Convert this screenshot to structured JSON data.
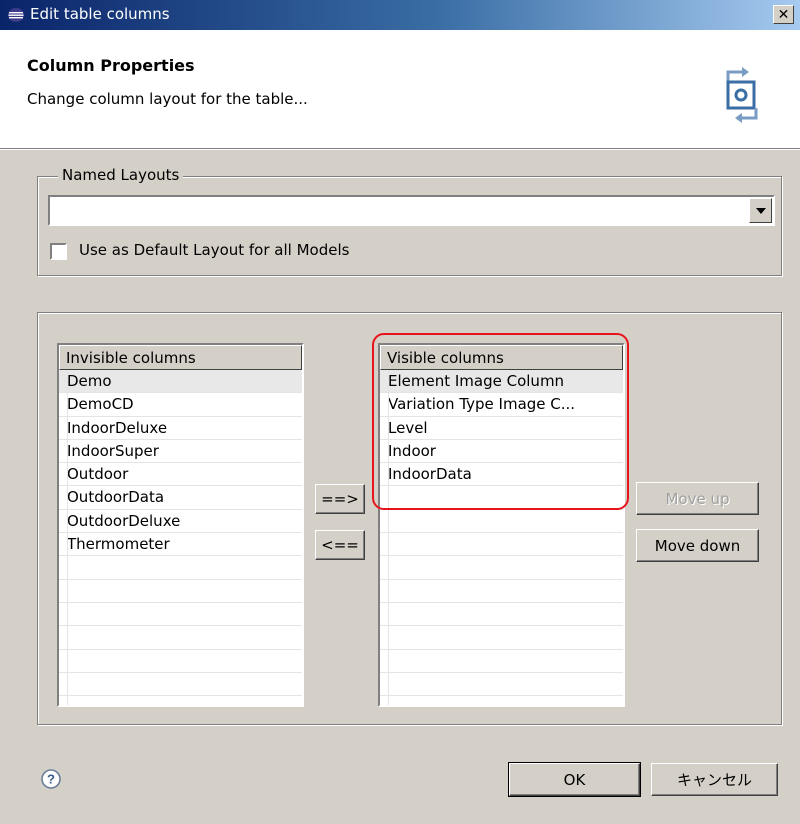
{
  "window": {
    "title": "Edit table columns",
    "close_glyph": "✕"
  },
  "header": {
    "title": "Column Properties",
    "description": "Change column layout for the table..."
  },
  "named_layouts": {
    "legend": "Named Layouts",
    "selected_value": "",
    "checkbox_label": "Use as Default Layout for all Models",
    "checkbox_checked": false
  },
  "invisible_columns": {
    "header": "Invisible columns",
    "items": [
      "Demo",
      "DemoCD",
      "IndoorDeluxe",
      "IndoorSuper",
      "Outdoor",
      "OutdoorData",
      "OutdoorDeluxe",
      "Thermometer",
      "",
      "",
      "",
      "",
      "",
      "",
      ""
    ]
  },
  "visible_columns": {
    "header": "Visible columns",
    "items": [
      "Element Image Column",
      "Variation Type Image C...",
      "Level",
      "Indoor",
      "IndoorData",
      "",
      "",
      "",
      "",
      "",
      "",
      "",
      "",
      "",
      ""
    ]
  },
  "buttons": {
    "add": "==>",
    "remove": "<==",
    "move_up": "Move up",
    "move_down": "Move down",
    "ok": "OK",
    "cancel": "キャンセル"
  },
  "colors": {
    "highlight": "#e8141c",
    "title_start": "#0a246a",
    "title_end": "#a6caf0"
  },
  "icons": {
    "app": "eclipse-icon",
    "header": "columns-refresh-icon",
    "help": "help-icon"
  }
}
